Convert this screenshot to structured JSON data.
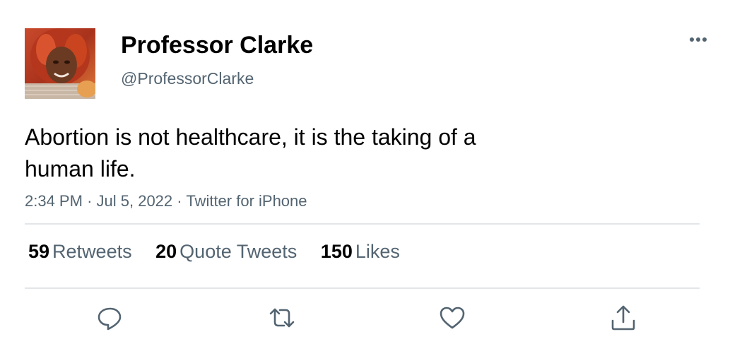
{
  "author": {
    "name": "Professor Clarke",
    "handle": "@ProfessorClarke"
  },
  "tweet": {
    "text_line1": "Abortion is not healthcare, it is the taking of a",
    "text_line2": "human life.",
    "time": "2:34 PM",
    "separator": "·",
    "date": "Jul 5, 2022",
    "source": "Twitter for iPhone"
  },
  "stats": {
    "retweets_count": "59",
    "retweets_label": "Retweets",
    "quotes_count": "20",
    "quotes_label": "Quote Tweets",
    "likes_count": "150",
    "likes_label": "Likes"
  },
  "icons": {
    "more": "more-horizontal-icon",
    "reply": "reply-icon",
    "retweet": "retweet-icon",
    "like": "heart-icon",
    "share": "share-icon"
  },
  "colors": {
    "text_primary": "#0f1419",
    "text_secondary": "#536471",
    "divider": "#e2e6e9"
  }
}
